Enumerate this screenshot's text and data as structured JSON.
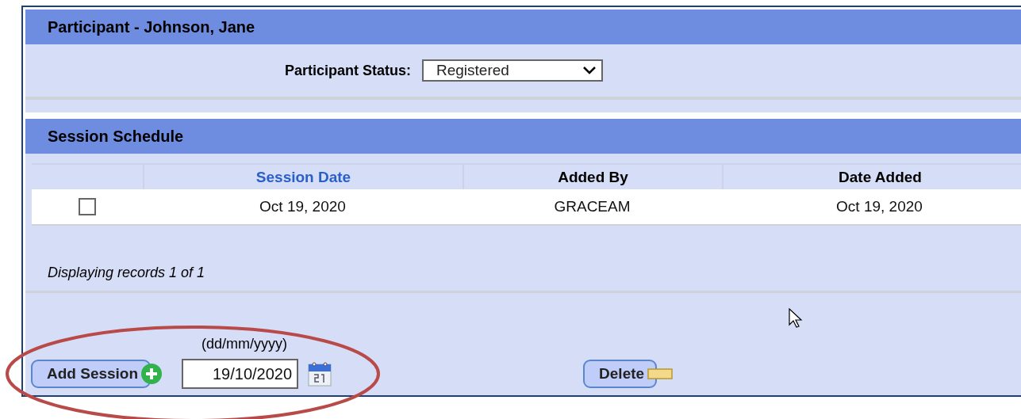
{
  "participant_panel": {
    "title": "Participant - Johnson, Jane",
    "status_label": "Participant Status:",
    "status_value": "Registered"
  },
  "session_panel": {
    "title": "Session Schedule",
    "columns": [
      {
        "label": "Session Date",
        "sortable": true
      },
      {
        "label": "Added By",
        "sortable": false
      },
      {
        "label": "Date Added",
        "sortable": false
      }
    ],
    "rows": [
      {
        "checked": false,
        "cells": [
          "Oct 19, 2020",
          "GRACEAM",
          "Oct 19, 2020"
        ]
      }
    ],
    "records_text": "Displaying records 1 of 1",
    "date_hint": "(dd/mm/yyyy)",
    "add_button": "Add Session",
    "date_value": "19/10/2020",
    "delete_button": "Delete"
  }
}
